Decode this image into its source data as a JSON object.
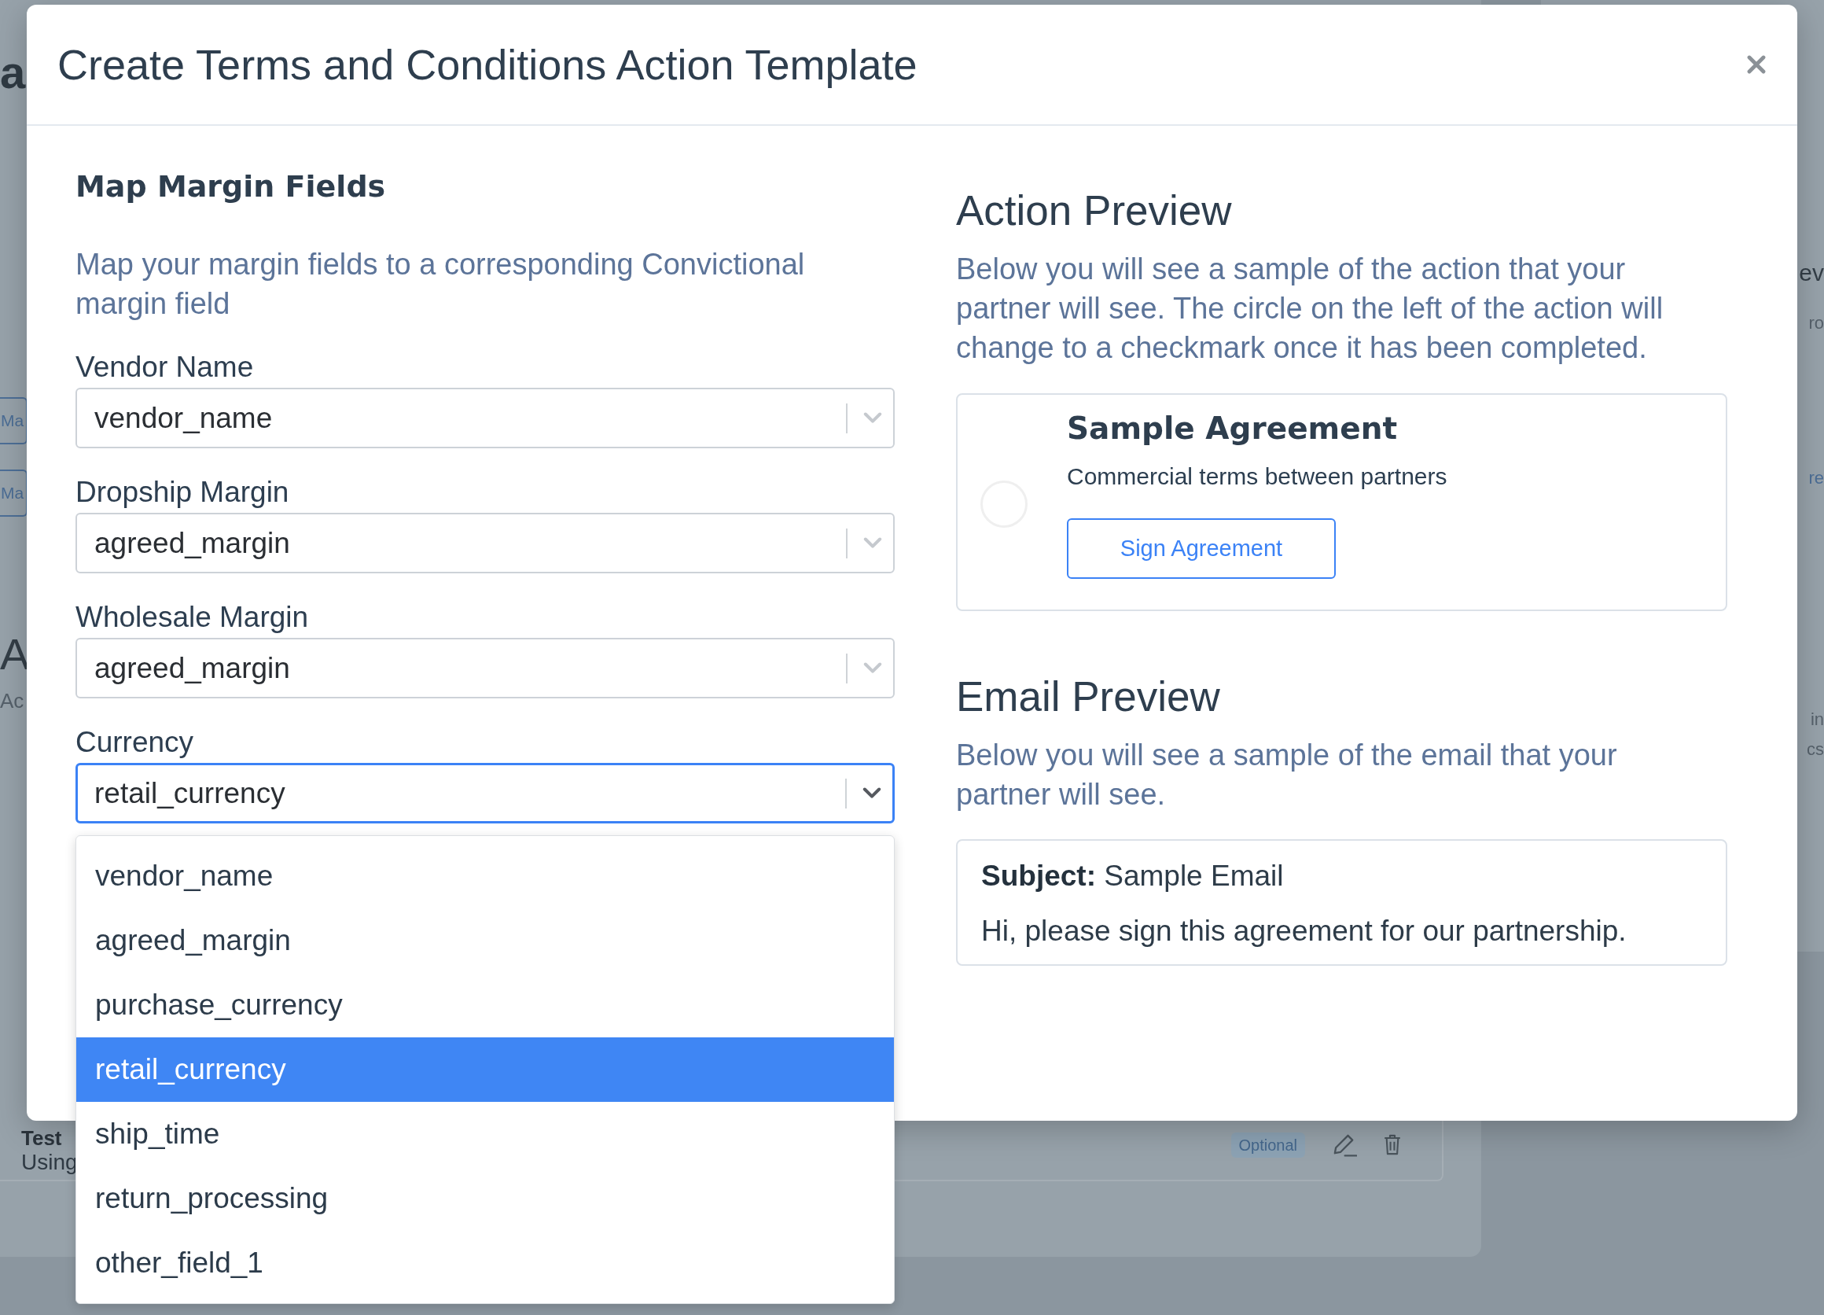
{
  "background_page": {
    "left_edge": [
      {
        "kind": "title",
        "text": "a"
      },
      {
        "kind": "button",
        "text": "Ma"
      },
      {
        "kind": "button",
        "text": "Ma"
      },
      {
        "kind": "heading",
        "text": "A"
      },
      {
        "kind": "caption",
        "text": "Ac"
      }
    ],
    "right_edge": [
      {
        "kind": "heading",
        "text": "ev"
      },
      {
        "kind": "caption",
        "text": "ro"
      },
      {
        "kind": "link",
        "text": "re"
      },
      {
        "kind": "caption",
        "text": "in"
      },
      {
        "kind": "caption",
        "text": "cs"
      }
    ],
    "list_row": {
      "title": "Test",
      "subtitle": "Using",
      "badge": "Optional"
    }
  },
  "modal": {
    "title": "Create Terms and Conditions Action Template",
    "mapping": {
      "heading": "Map Margin Fields",
      "description": "Map your margin fields to a corresponding Convictional margin field",
      "fields": [
        {
          "label": "Vendor Name",
          "value": "vendor_name",
          "open": false
        },
        {
          "label": "Dropship Margin",
          "value": "agreed_margin",
          "open": false
        },
        {
          "label": "Wholesale Margin",
          "value": "agreed_margin",
          "open": false
        },
        {
          "label": "Currency",
          "value": "retail_currency",
          "open": true
        }
      ],
      "options": [
        {
          "label": "vendor_name",
          "selected": false
        },
        {
          "label": "agreed_margin",
          "selected": false
        },
        {
          "label": "purchase_currency",
          "selected": false
        },
        {
          "label": "retail_currency",
          "selected": true
        },
        {
          "label": "ship_time",
          "selected": false
        },
        {
          "label": "return_processing",
          "selected": false
        },
        {
          "label": "other_field_1",
          "selected": false
        }
      ]
    },
    "action_preview": {
      "heading": "Action Preview",
      "description": "Below you will see a sample of the action that your partner will see. The circle on the left of the action will change to a checkmark once it has been completed.",
      "card": {
        "completed": false,
        "title": "Sample Agreement",
        "subtitle": "Commercial terms between partners",
        "button": "Sign Agreement"
      }
    },
    "email_preview": {
      "heading": "Email Preview",
      "description": "Below you will see a sample of the email that your partner will see.",
      "subject": "**Subject:** Sample Email",
      "body": "Hi, please sign this agreement for our partnership."
    }
  }
}
